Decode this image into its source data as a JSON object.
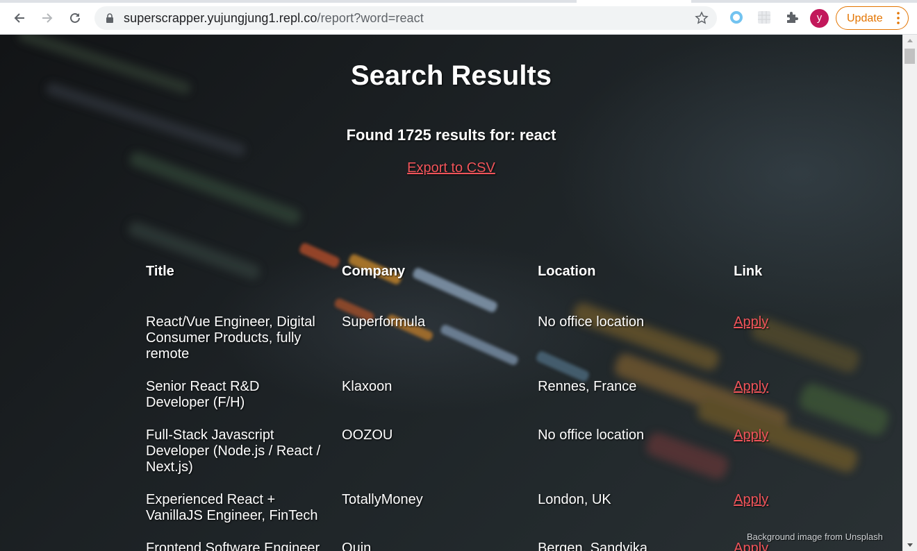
{
  "browser": {
    "url_host": "superscrapper.yujungjung1.repl.co",
    "url_path": "/report?word=react",
    "profile_initial": "y",
    "update_label": "Update"
  },
  "page": {
    "heading": "Search Results",
    "found_prefix": "Found 1725 results for:",
    "keyword": "react",
    "export_label": "Export to CSV",
    "credit": "Background image from Unsplash"
  },
  "table": {
    "headers": [
      "Title",
      "Company",
      "Location",
      "Link"
    ],
    "rows": [
      {
        "title": "React/Vue Engineer, Digital Consumer Products, fully remote",
        "company": "Superformula",
        "location": "No office location",
        "link": "Apply"
      },
      {
        "title": "Senior React R&D Developer (F/H)",
        "company": "Klaxoon",
        "location": "Rennes, France",
        "link": "Apply"
      },
      {
        "title": "Full-Stack Javascript Developer (Node.js / React / Next.js)",
        "company": "OOZOU",
        "location": "No office location",
        "link": "Apply"
      },
      {
        "title": "Experienced React + VanillaJS Engineer, FinTech",
        "company": "TotallyMoney",
        "location": "London, UK",
        "link": "Apply"
      },
      {
        "title": "Frontend Software Engineer",
        "company": "Quin",
        "location": "Bergen, Sandvika",
        "link": "Apply"
      }
    ]
  },
  "colors": {
    "link": "#f0545a",
    "update_accent": "#e37400",
    "avatar": "#c2185b"
  },
  "icons": [
    "back-arrow-icon",
    "forward-arrow-icon",
    "reload-icon",
    "lock-icon",
    "star-icon",
    "extension-ring-icon",
    "extension-grid-icon",
    "puzzle-icon",
    "kebab-menu-icon"
  ]
}
